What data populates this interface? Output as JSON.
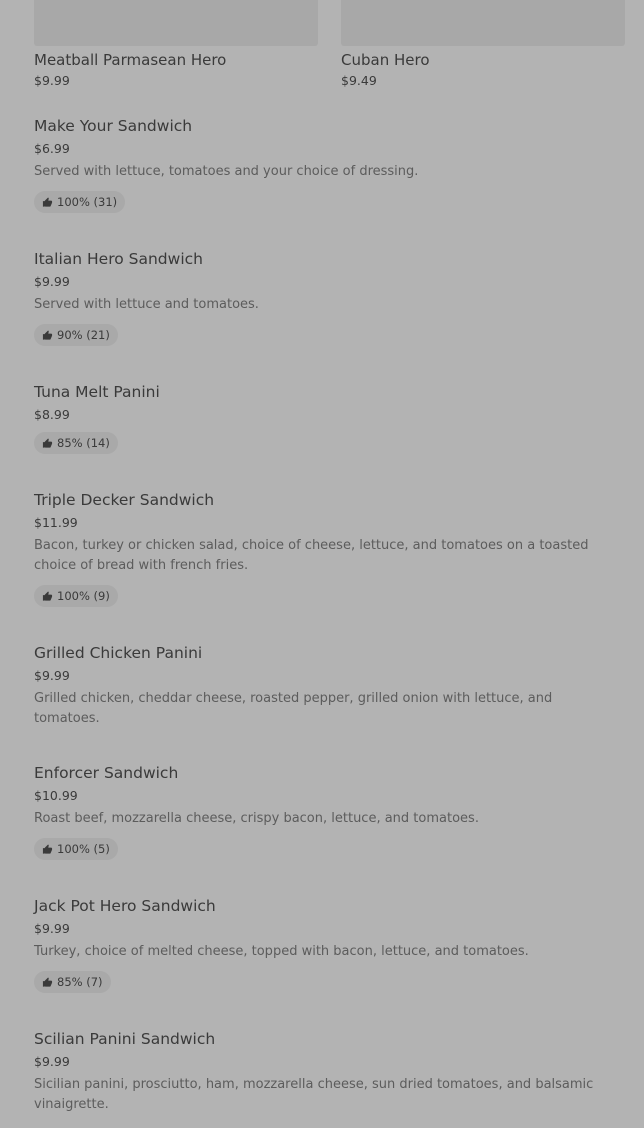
{
  "top_cards": [
    {
      "name": "Meatball Parmasean Hero",
      "price": "$9.99"
    },
    {
      "name": "Cuban Hero",
      "price": "$9.49"
    }
  ],
  "items": [
    {
      "name": "Make Your Sandwich",
      "price": "$6.99",
      "desc": "Served with lettuce, tomatoes and your choice of dressing.",
      "rating": "100% (31)"
    },
    {
      "name": "Italian Hero Sandwich",
      "price": "$9.99",
      "desc": "Served with lettuce and tomatoes.",
      "rating": "90% (21)"
    },
    {
      "name": "Tuna Melt Panini",
      "price": "$8.99",
      "desc": "",
      "rating": "85% (14)"
    },
    {
      "name": "Triple Decker Sandwich",
      "price": "$11.99",
      "desc": "Bacon, turkey or chicken salad, choice of cheese, lettuce, and tomatoes on a toasted choice of bread with french fries.",
      "rating": "100% (9)"
    },
    {
      "name": "Grilled Chicken Panini",
      "price": "$9.99",
      "desc": "Grilled chicken, cheddar cheese, roasted pepper, grilled onion with lettuce, and tomatoes.",
      "rating": ""
    },
    {
      "name": "Enforcer Sandwich",
      "price": "$10.99",
      "desc": "Roast beef, mozzarella cheese, crispy bacon, lettuce, and tomatoes.",
      "rating": "100% (5)"
    },
    {
      "name": "Jack Pot Hero Sandwich",
      "price": "$9.99",
      "desc": "Turkey, choice of melted cheese, topped with bacon, lettuce, and tomatoes.",
      "rating": "85% (7)"
    },
    {
      "name": "Scilian Panini Sandwich",
      "price": "$9.99",
      "desc": "Sicilian panini, prosciutto, ham, mozzarella cheese, sun dried tomatoes, and balsamic vinaigrette.",
      "rating": ""
    }
  ],
  "icons": {
    "rating": "thumbs-up-icon"
  },
  "colors": {
    "background": "#b3b3b3",
    "badge": "#a9a9a9",
    "text": "#3a3a3a",
    "desc": "#5c5c5c"
  }
}
